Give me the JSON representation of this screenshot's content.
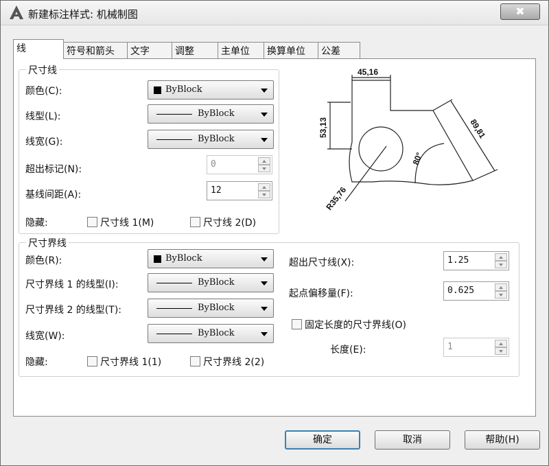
{
  "window": {
    "title": "新建标注样式: 机械制图",
    "close_symbol": "✖"
  },
  "tabs": [
    {
      "label": "线",
      "active": true
    },
    {
      "label": "符号和箭头"
    },
    {
      "label": "文字"
    },
    {
      "label": "调整"
    },
    {
      "label": "主单位"
    },
    {
      "label": "换算单位"
    },
    {
      "label": "公差"
    }
  ],
  "dim_lines": {
    "title": "尺寸线",
    "color_label": "颜色(C):",
    "color_value": "ByBlock",
    "linetype_label": "线型(L):",
    "linetype_value": "ByBlock",
    "lineweight_label": "线宽(G):",
    "lineweight_value": "ByBlock",
    "extend_label": "超出标记(N):",
    "extend_value": "0",
    "baseline_label": "基线间距(A):",
    "baseline_value": "12",
    "suppress_label": "隐藏:",
    "suppress1": "尺寸线 1(M)",
    "suppress2": "尺寸线 2(D)"
  },
  "ext_lines": {
    "title": "尺寸界线",
    "color_label": "颜色(R):",
    "color_value": "ByBlock",
    "linetype1_label": "尺寸界线 1 的线型(I):",
    "linetype1_value": "ByBlock",
    "linetype2_label": "尺寸界线 2 的线型(T):",
    "linetype2_value": "ByBlock",
    "lineweight_label": "线宽(W):",
    "lineweight_value": "ByBlock",
    "suppress_label": "隐藏:",
    "suppress1": "尺寸界线 1(1)",
    "suppress2": "尺寸界线 2(2)",
    "extend_label": "超出尺寸线(X):",
    "extend_value": "1.25",
    "offset_label": "起点偏移量(F):",
    "offset_value": "0.625",
    "fixed_label": "固定长度的尺寸界线(O)",
    "length_label": "长度(E):",
    "length_value": "1"
  },
  "preview": {
    "dim_top": "45,16",
    "dim_left": "53,13",
    "dim_right": "89,81",
    "dim_angle": "80°",
    "dim_radius": "R35,76"
  },
  "buttons": {
    "ok": "确定",
    "cancel": "取消",
    "help": "帮助(H)"
  }
}
